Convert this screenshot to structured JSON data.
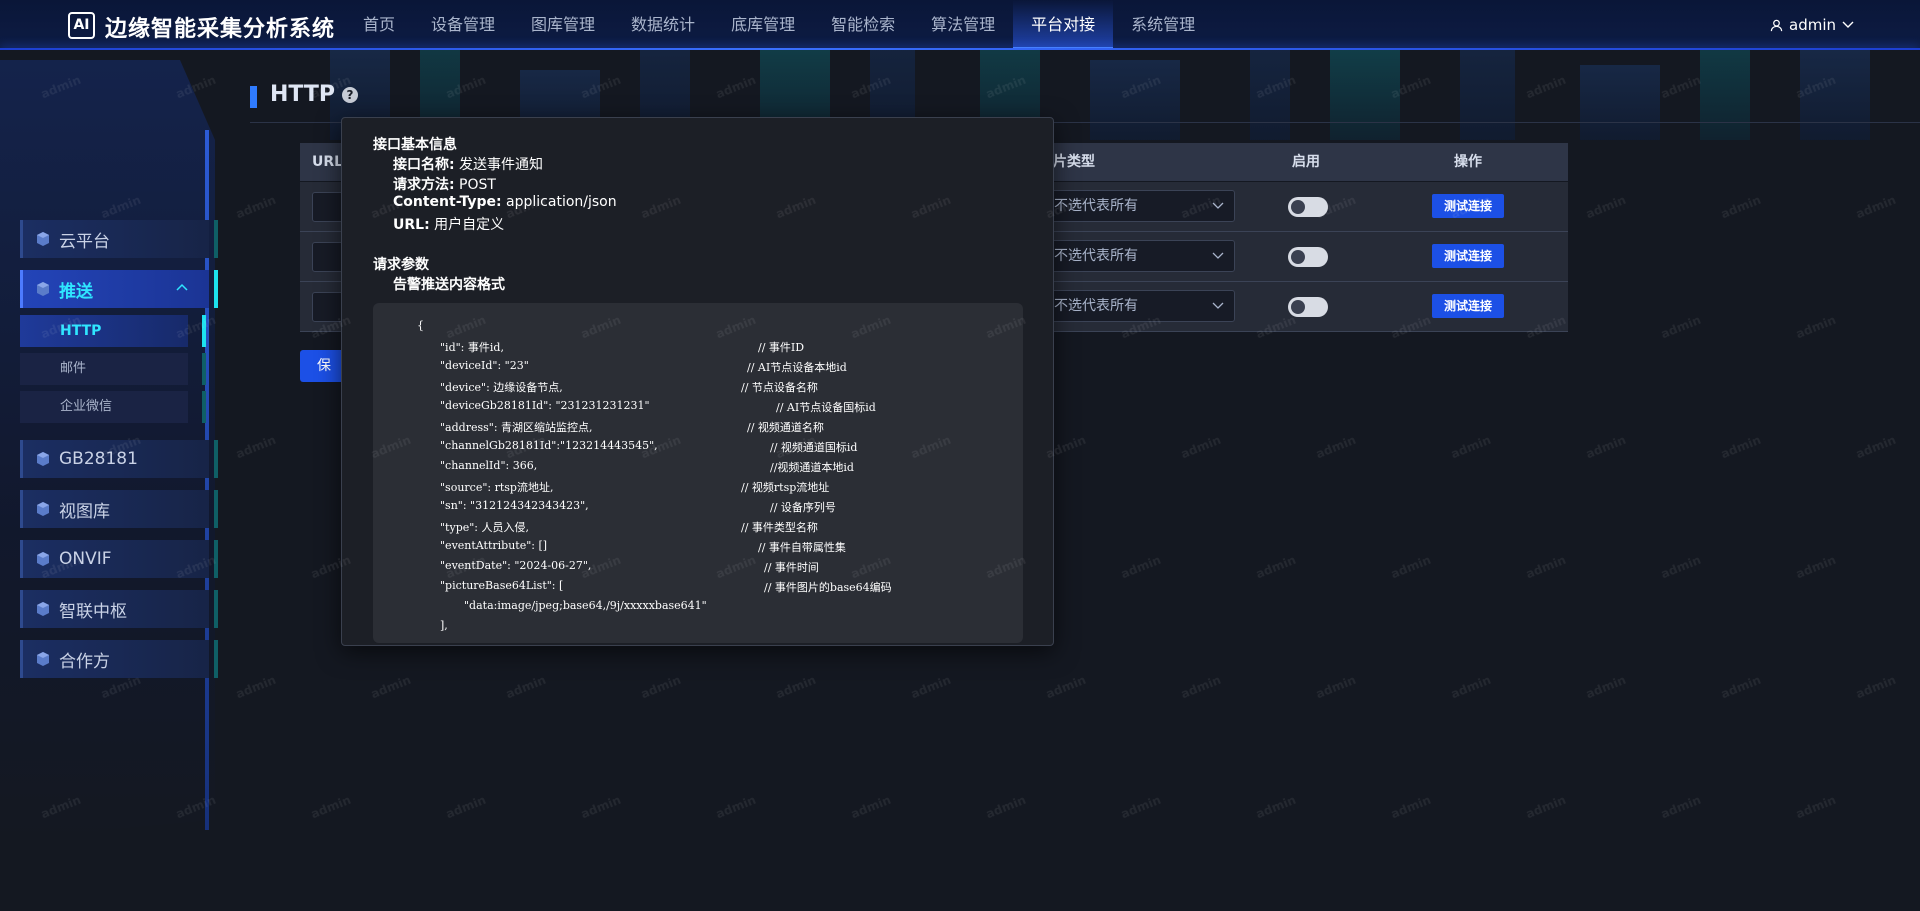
{
  "header": {
    "logo_text": "AI",
    "app_title": "边缘智能采集分析系统",
    "nav": [
      "首页",
      "设备管理",
      "图库管理",
      "数据统计",
      "底库管理",
      "智能检索",
      "算法管理",
      "平台对接",
      "系统管理"
    ],
    "active_nav_index": 7,
    "user": "admin"
  },
  "sidebar": {
    "items": [
      {
        "label": "云平台",
        "icon": "cube-icon"
      },
      {
        "label": "推送",
        "icon": "cube-icon",
        "open": true
      },
      {
        "label": "GB28181",
        "icon": "cube-icon"
      },
      {
        "label": "视图库",
        "icon": "cube-icon"
      },
      {
        "label": "ONVIF",
        "icon": "cube-icon"
      },
      {
        "label": "智联中枢",
        "icon": "cube-icon"
      },
      {
        "label": "合作方",
        "icon": "cube-icon"
      }
    ],
    "sub_items": [
      {
        "label": "HTTP",
        "active": true
      },
      {
        "label": "邮件"
      },
      {
        "label": "企业微信"
      }
    ]
  },
  "page": {
    "title": "HTTP",
    "help_icon": "?"
  },
  "table": {
    "columns": [
      "URL",
      "片类型",
      "启用",
      "操作"
    ],
    "rows": [
      {
        "type_select": "不选代表所有",
        "enabled": false,
        "action": "测试连接"
      },
      {
        "type_select": "不选代表所有",
        "enabled": false,
        "action": "测试连接"
      },
      {
        "type_select": "不选代表所有",
        "enabled": false,
        "action": "测试连接"
      }
    ],
    "add_button": "保"
  },
  "popover": {
    "section1": "接口基本信息",
    "fields": [
      {
        "k": "接口名称:",
        "v": " 发送事件通知"
      },
      {
        "k": "请求方法:",
        "v": " POST"
      },
      {
        "k": "Content-Type:",
        "v": " application/json"
      },
      {
        "k": "URL:",
        "v": " 用户自定义"
      }
    ],
    "section2": "请求参数",
    "sub_title": "告警推送内容格式",
    "code": [
      {
        "t": "{",
        "c": ""
      },
      {
        "t": "\"id\": 事件id,",
        "c": "// 事件ID"
      },
      {
        "t": "\"deviceId\": \"23\"",
        "c": "// AI节点设备本地id"
      },
      {
        "t": "\"device\": 边缘设备节点,",
        "c": "// 节点设备名称"
      },
      {
        "t": "\"deviceGb28181Id\": \"231231231231\"",
        "c": "// AI节点设备国标id"
      },
      {
        "t": "\"address\": 青湖区缩站监控点,",
        "c": "// 视频通道名称"
      },
      {
        "t": "\"channelGb28181Id\":\"123214443545\",",
        "c": "// 视频通道国标id"
      },
      {
        "t": "\"channelId\": 366,",
        "c": "//视频通道本地id"
      },
      {
        "t": "\"source\": rtsp流地址,",
        "c": "// 视频rtsp流地址"
      },
      {
        "t": "\"sn\": \"312124342343423\",",
        "c": "// 设备序列号"
      },
      {
        "t": "\"type\": 人员入侵,",
        "c": "// 事件类型名称"
      },
      {
        "t": "\"eventAttribute\": []",
        "c": "// 事件自带属性集"
      },
      {
        "t": "\"eventDate\": \"2024-06-27\",",
        "c": "// 事件时间"
      },
      {
        "t": "\"pictureBase64List\": [",
        "c": "// 事件图片的base64编码"
      },
      {
        "t": "\"data:image/jpeg;base64,/9j/xxxxxbase641\"",
        "c": ""
      },
      {
        "t": "],",
        "c": ""
      }
    ]
  },
  "watermark": "admin",
  "colors": {
    "accent": "#1c50e6",
    "active_cyan": "#2fe6ff",
    "header_bg": "#0a1638",
    "page_bg": "#141821"
  }
}
